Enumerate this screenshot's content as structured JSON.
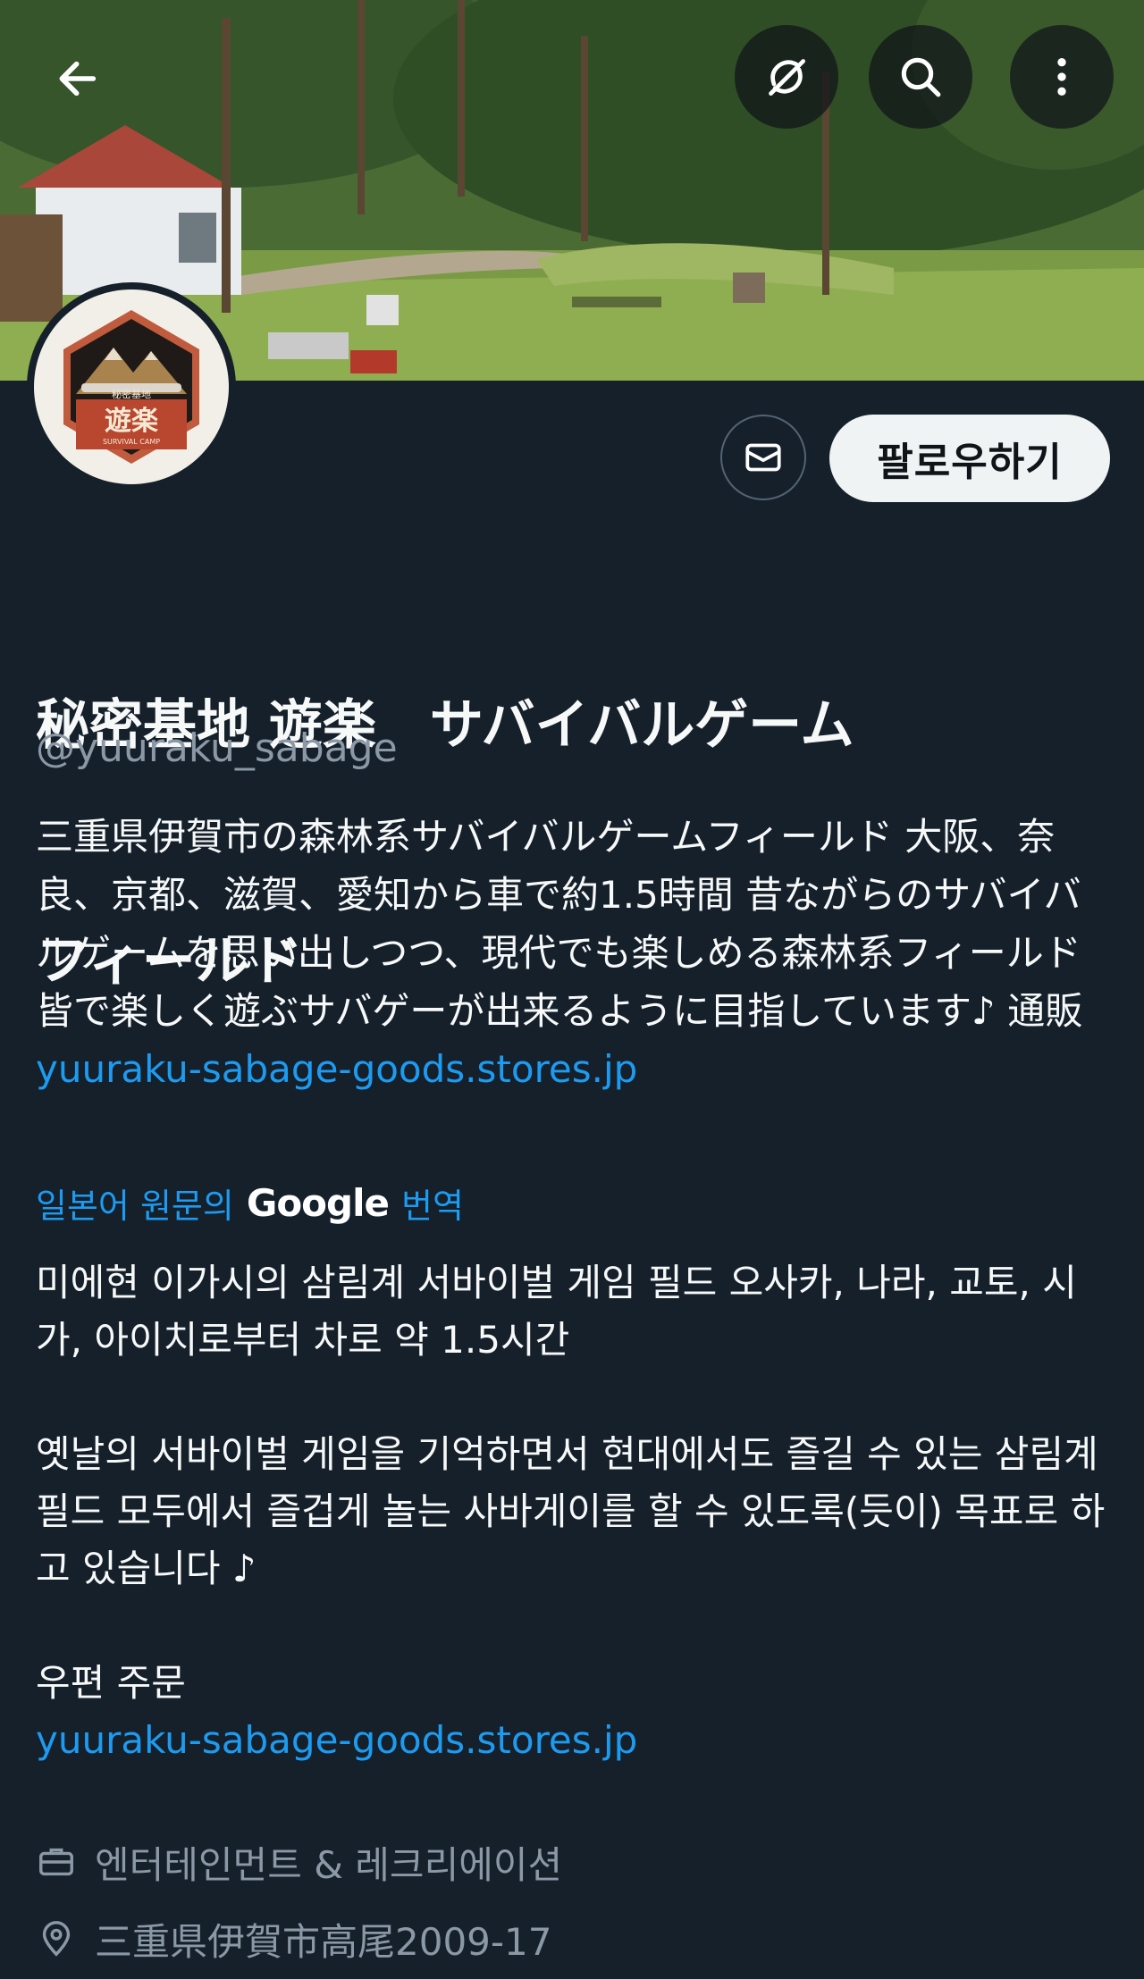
{
  "header": {
    "back_icon": "arrow-left-icon",
    "buttons": [
      "no-repost-icon",
      "search-icon",
      "more-vertical-icon"
    ]
  },
  "profile": {
    "name_line1": "秘密基地 遊楽　サバイバルゲーム",
    "name_line2": "フィールド",
    "handle": "@yuuraku_sabage",
    "follow_label": "팔로우하기",
    "avatar_text_top": "秘密基地",
    "avatar_text_main": "遊楽",
    "avatar_text_sub": "SURVIVAL CAMP"
  },
  "bio": {
    "text": "三重県伊賀市の森林系サバイバルゲームフィールド 大阪、奈良、京都、滋賀、愛知から車で約1.5時間  昔ながらのサバイバルゲームを思い出しつつ、現代でも楽しめる森林系フィールド 皆で楽しく遊ぶサバゲーが出来るように目指しています♪  通販 ",
    "link": "yuuraku-sabage-goods.stores.jp"
  },
  "translation": {
    "source_label": "일본어 원문의",
    "provider": "Google",
    "action_label": "번역",
    "paragraphs": [
      "미에현 이가시의 삼림계 서바이벌 게임 필드 오사카, 나라, 교토, 시가, 아이치로부터 차로 약 1.5시간",
      "",
      "옛날의 서바이벌 게임을 기억하면서 현대에서도 즐길 수 있는 삼림계 필드 모두에서 즐겁게 놀는 사바게이를 할 수 있도록(듯이) 목표로 하고 있습니다 ♪",
      "",
      "우편 주문"
    ],
    "link": "yuuraku-sabage-goods.stores.jp"
  },
  "meta": {
    "category": "엔터테인먼트 & 레크리에이션",
    "category_icon": "briefcase-icon",
    "location": "三重県伊賀市高尾2009-17",
    "location_icon": "location-pin-icon"
  },
  "colors": {
    "background": "#15202b",
    "link": "#1d9bf0",
    "secondary_text": "#8b98a5",
    "follow_bg": "#eff3f4"
  }
}
